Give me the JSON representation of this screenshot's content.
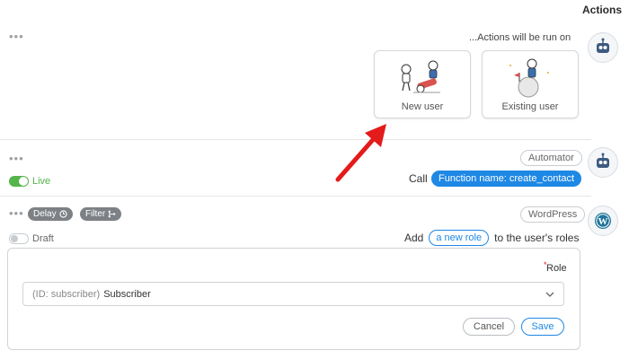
{
  "header": {
    "title": "Actions"
  },
  "trigger": {
    "run_on_label": "...Actions will be run on",
    "options": [
      {
        "label": "New user"
      },
      {
        "label": "Existing user"
      }
    ]
  },
  "action1": {
    "integration": "Automator",
    "status": "Live",
    "verb": "Call",
    "token_key": "Function name:",
    "token_value": "create_contact"
  },
  "action2": {
    "integration": "WordPress",
    "status": "Draft",
    "delay_label": "Delay",
    "filter_label": "Filter",
    "sentence_start": "Add",
    "link_label": "a new role",
    "sentence_end": "to the user's roles",
    "form": {
      "required_mark": "*",
      "role_label": "Role",
      "select_prefix": "(ID: subscriber)",
      "select_value": "Subscriber",
      "cancel_label": "Cancel",
      "save_label": "Save"
    }
  },
  "colors": {
    "accent": "#1e88e5",
    "live": "#53b54a",
    "arrow": "#e31b1b"
  }
}
